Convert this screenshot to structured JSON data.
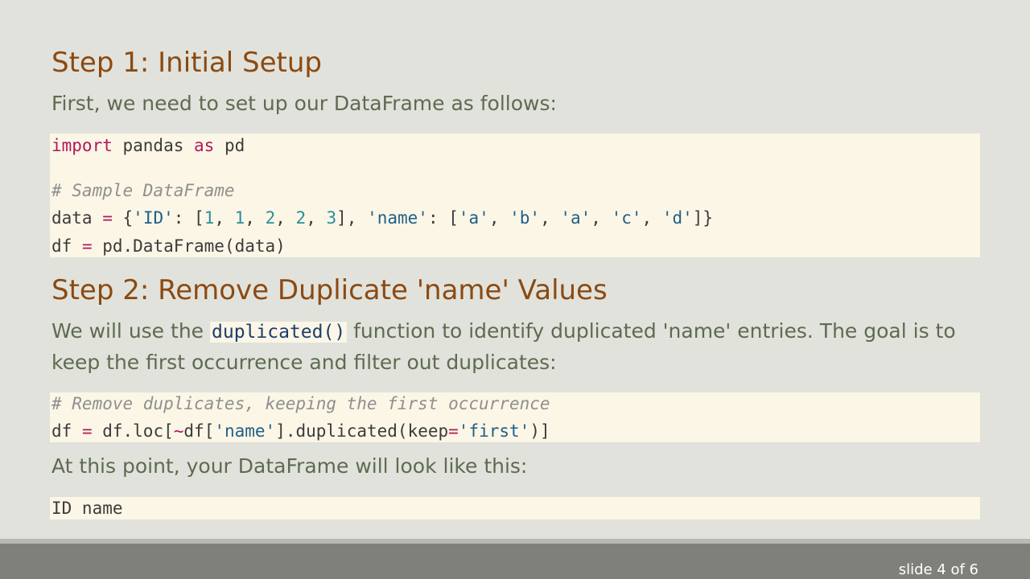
{
  "step1": {
    "title": "Step 1: Initial Setup",
    "intro": "First, we need to set up our DataFrame as follows:"
  },
  "code1": {
    "import_kw": "import",
    "import_mod": " pandas ",
    "as_kw": "as",
    "alias": " pd",
    "comment": "# Sample DataFrame",
    "data_line": {
      "var": "data ",
      "eq": "=",
      "open": " {",
      "key_id": "'ID'",
      "colon1": ": [",
      "n1": "1",
      "c1": ", ",
      "n2": "1",
      "c2": ", ",
      "n3": "2",
      "c3": ", ",
      "n4": "2",
      "c4": ", ",
      "n5": "3",
      "close1": "], ",
      "key_name": "'name'",
      "colon2": ": [",
      "s1": "'a'",
      "d1": ", ",
      "s2": "'b'",
      "d2": ", ",
      "s3": "'a'",
      "d3": ", ",
      "s4": "'c'",
      "d4": ", ",
      "s5": "'d'",
      "close2": "]}"
    },
    "df_line": {
      "var": "df ",
      "eq": "=",
      "rest": " pd.DataFrame(data)"
    }
  },
  "step2": {
    "title": "Step 2: Remove Duplicate 'name' Values",
    "text_before": "We will use the ",
    "inline_code": "duplicated()",
    "text_after": " function to identify duplicated 'name' entries. The goal is to keep the first occurrence and filter out duplicates:"
  },
  "code2": {
    "comment": "# Remove duplicates, keeping the first occurrence",
    "var": "df ",
    "eq": "=",
    "part1": " df.loc[",
    "tilde": "~",
    "part2": "df[",
    "key": "'name'",
    "part3": "].duplicated(keep",
    "eq2": "=",
    "keep_val": "'first'",
    "part4": ")]"
  },
  "result": {
    "text": "At this point, your DataFrame will look like this:",
    "header": "ID name"
  },
  "footer": {
    "slide_number": "slide 4 of 6"
  }
}
